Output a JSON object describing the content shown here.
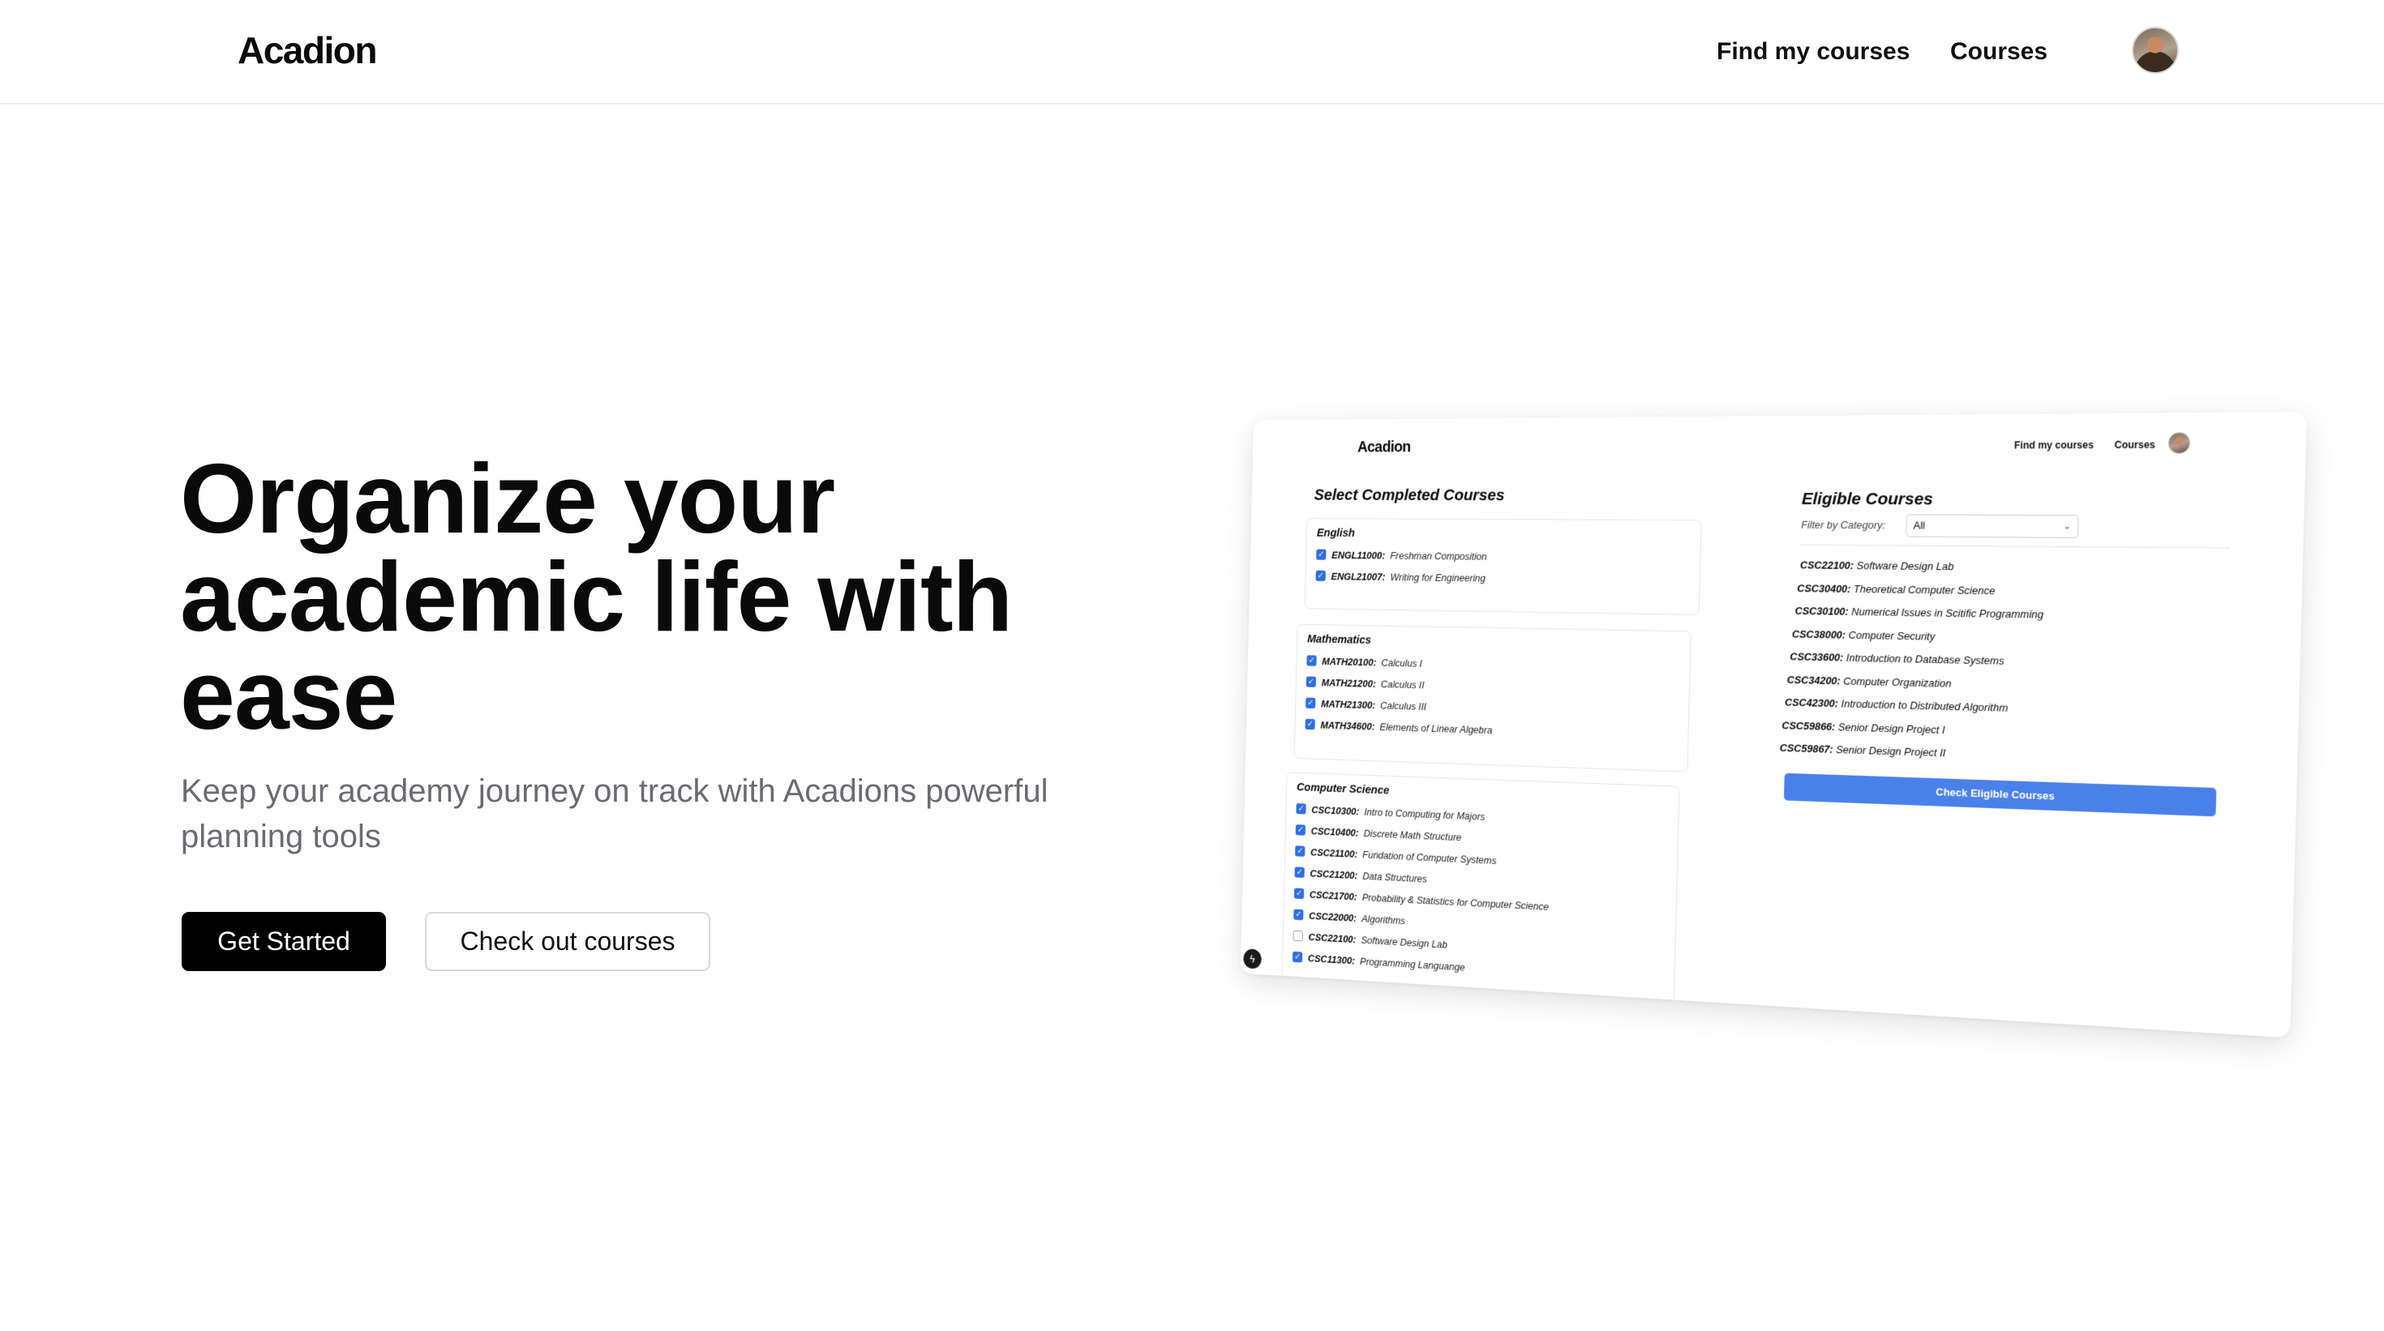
{
  "nav": {
    "brand": "Acadion",
    "links": [
      "Find my courses",
      "Courses"
    ]
  },
  "hero": {
    "title": "Organize your academic life with ease",
    "subtitle": "Keep your academy journey on track with Acadions powerful planning tools",
    "primary_button": "Get Started",
    "secondary_button": "Check out courses"
  },
  "preview": {
    "brand": "Acadion",
    "nav_links": [
      "Find my courses",
      "Courses"
    ],
    "left_title": "Select Completed Courses",
    "groups": [
      {
        "title": "English",
        "items": [
          {
            "code": "ENGL11000:",
            "name": "Freshman Composition",
            "checked": true
          },
          {
            "code": "ENGL21007:",
            "name": "Writing for Engineering",
            "checked": true
          }
        ]
      },
      {
        "title": "Mathematics",
        "items": [
          {
            "code": "MATH20100:",
            "name": "Calculus I",
            "checked": true
          },
          {
            "code": "MATH21200:",
            "name": "Calculus II",
            "checked": true
          },
          {
            "code": "MATH21300:",
            "name": "Calculus III",
            "checked": true
          },
          {
            "code": "MATH34600:",
            "name": "Elements of Linear Algebra",
            "checked": true
          }
        ]
      },
      {
        "title": "Computer Science",
        "items": [
          {
            "code": "CSC10300:",
            "name": "Intro to Computing for Majors",
            "checked": true
          },
          {
            "code": "CSC10400:",
            "name": "Discrete Math Structure",
            "checked": true
          },
          {
            "code": "CSC21100:",
            "name": "Fundation of Computer Systems",
            "checked": true
          },
          {
            "code": "CSC21200:",
            "name": "Data Structures",
            "checked": true
          },
          {
            "code": "CSC21700:",
            "name": "Probability & Statistics for Computer Science",
            "checked": true
          },
          {
            "code": "CSC22000:",
            "name": "Algorithms",
            "checked": true
          },
          {
            "code": "CSC22100:",
            "name": "Software Design Lab",
            "checked": false
          },
          {
            "code": "CSC11300:",
            "name": "Programming Languange",
            "checked": true
          }
        ]
      }
    ],
    "right_title": "Eligible Courses",
    "filter_label": "Filter by Category:",
    "filter_value": "All",
    "eligible": [
      {
        "code": "CSC22100:",
        "name": "Software Design Lab"
      },
      {
        "code": "CSC30400:",
        "name": "Theoretical Computer Science"
      },
      {
        "code": "CSC30100:",
        "name": "Numerical Issues in Scitific Programming"
      },
      {
        "code": "CSC38000:",
        "name": "Computer Security"
      },
      {
        "code": "CSC33600:",
        "name": "Introduction to Database Systems"
      },
      {
        "code": "CSC34200:",
        "name": "Computer Organization"
      },
      {
        "code": "CSC42300:",
        "name": "Introduction to Distributed Algorithm"
      },
      {
        "code": "CSC59866:",
        "name": "Senior Design Project I"
      },
      {
        "code": "CSC59867:",
        "name": "Senior Design Project II"
      }
    ],
    "check_button": "Check Eligible Courses",
    "accent": "#4a80ea",
    "checkbox_color": "#2f6fe4"
  }
}
